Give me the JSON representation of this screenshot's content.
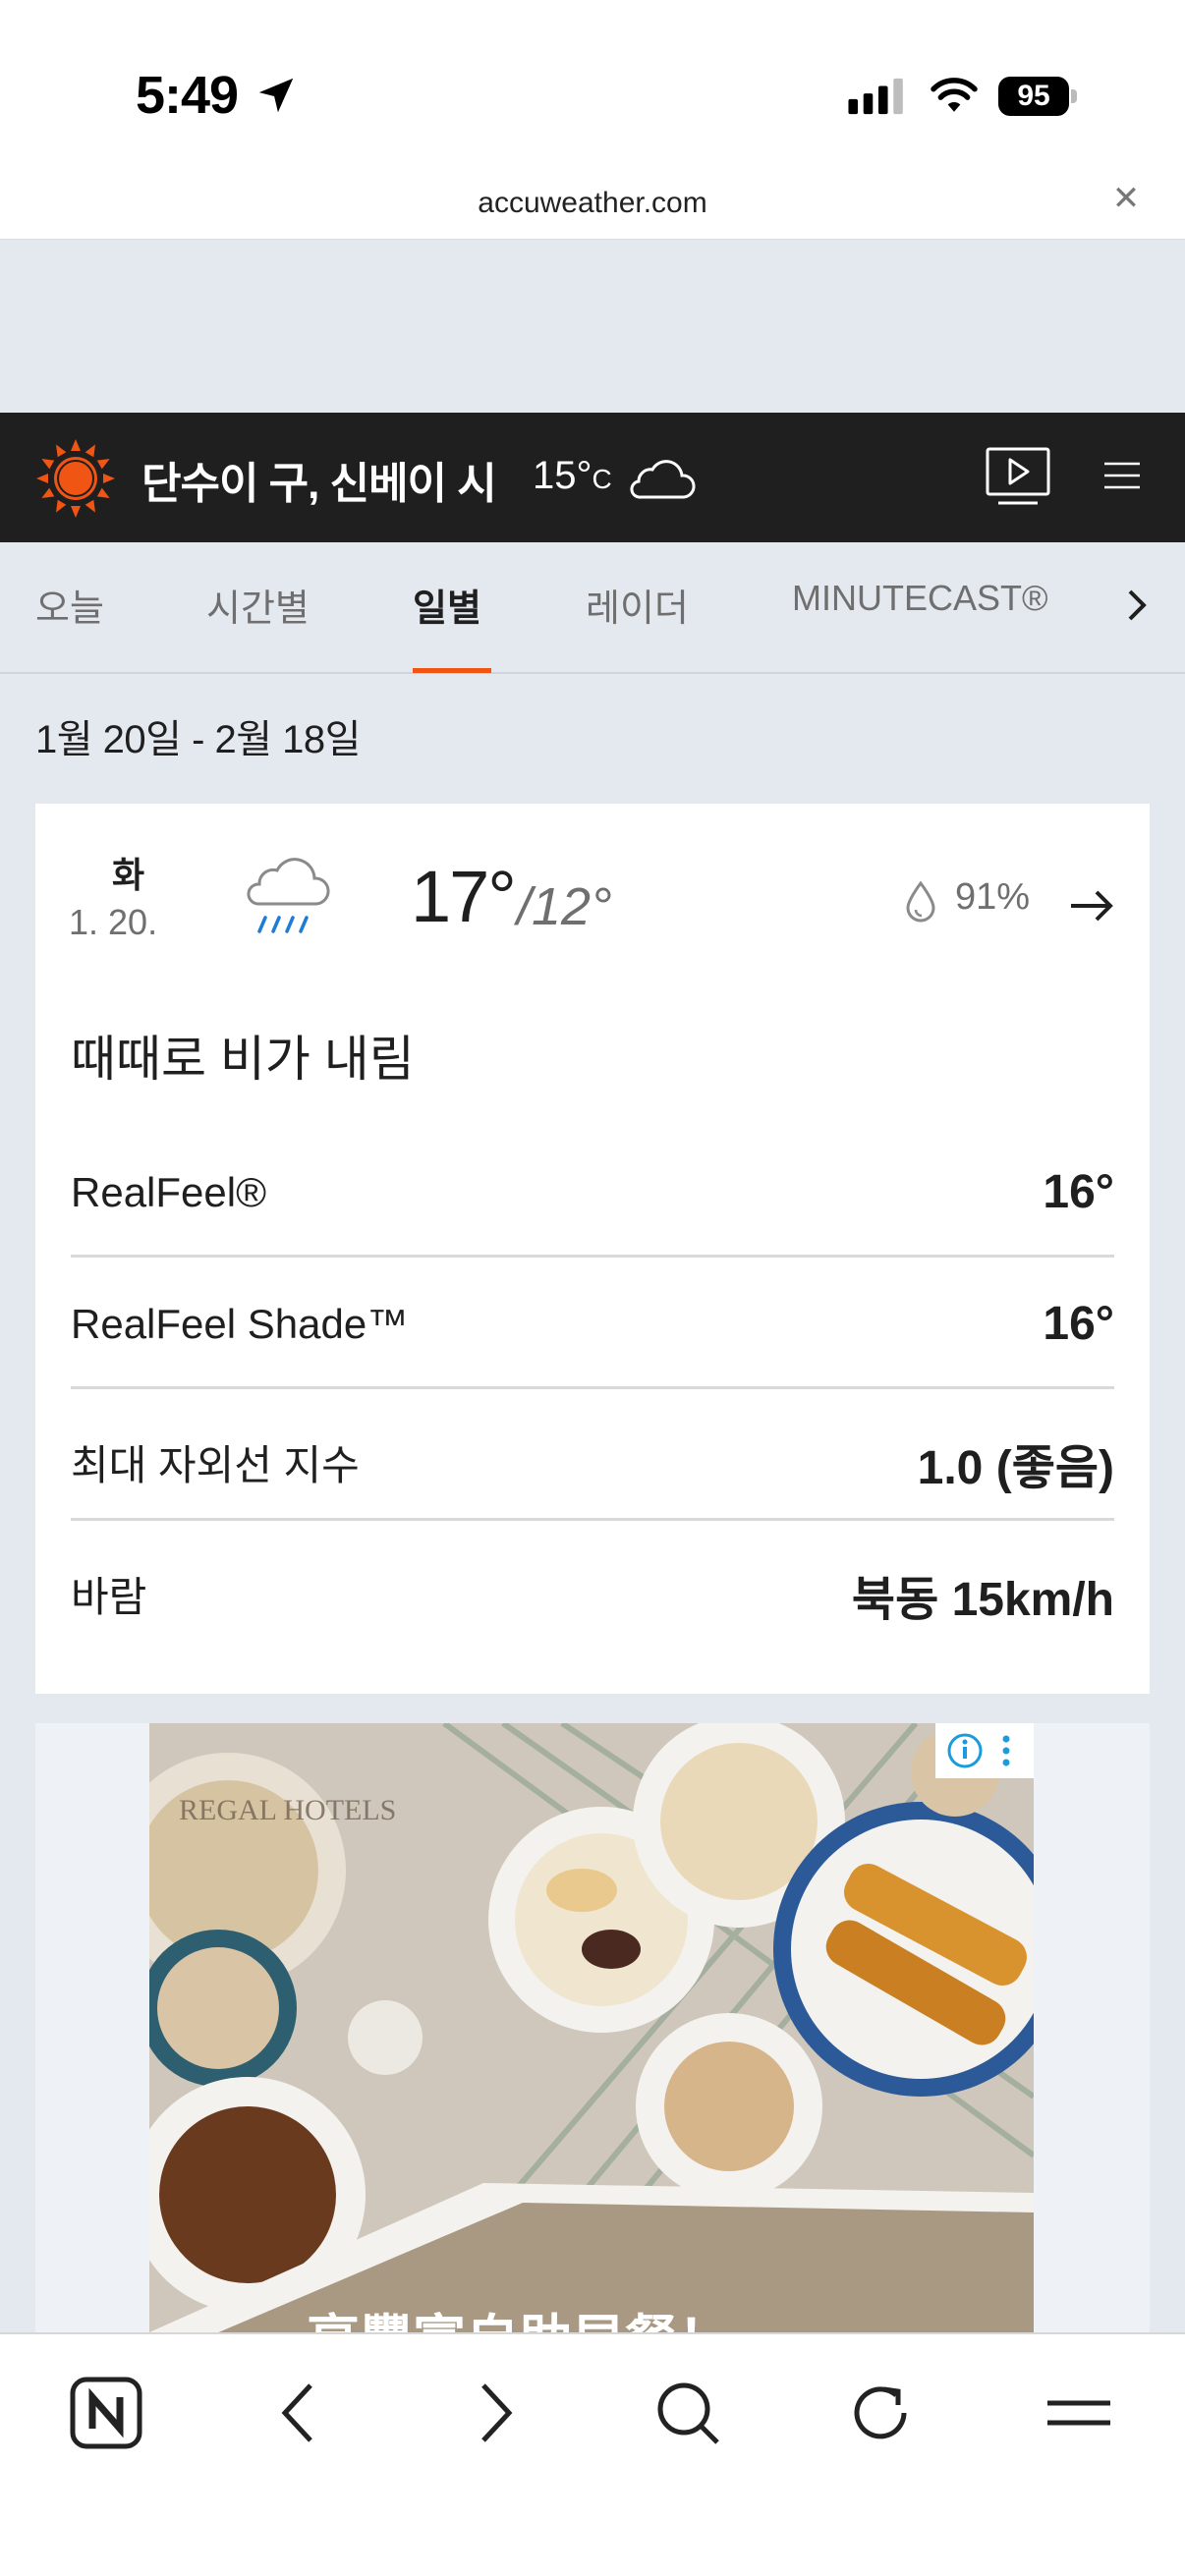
{
  "status_bar": {
    "time": "5:49",
    "battery": "95"
  },
  "browser": {
    "url": "accuweather.com"
  },
  "header": {
    "location": "단수이 구, 신베이 시",
    "temp": "15°",
    "unit": "C"
  },
  "tabs": [
    "오늘",
    "시간별",
    "일별",
    "레이더",
    "MINUTECAST®"
  ],
  "active_tab": "일별",
  "date_range": "1월 20일 - 2월 18일",
  "day": {
    "dow": "화",
    "date": "1. 20.",
    "high": "17°",
    "low": "/12°",
    "precip": "91%",
    "phrase": "때때로 비가 내림",
    "details": [
      {
        "label": "RealFeel®",
        "value": "16°"
      },
      {
        "label": "RealFeel Shade™",
        "value": "16°"
      },
      {
        "label": "최대 자외선 지수",
        "value": "1.0 (좋음)"
      },
      {
        "label": "바람",
        "value": "북동 15km/h"
      }
    ]
  },
  "ad": {
    "brand": "REGAL HOTELS",
    "headline": "享豐富自助早餐！"
  },
  "colors": {
    "accent": "#f05514",
    "header_bg": "#1f1f1f",
    "page_bg": "#e4e8ef",
    "rain_blue": "#1e7bd6"
  }
}
